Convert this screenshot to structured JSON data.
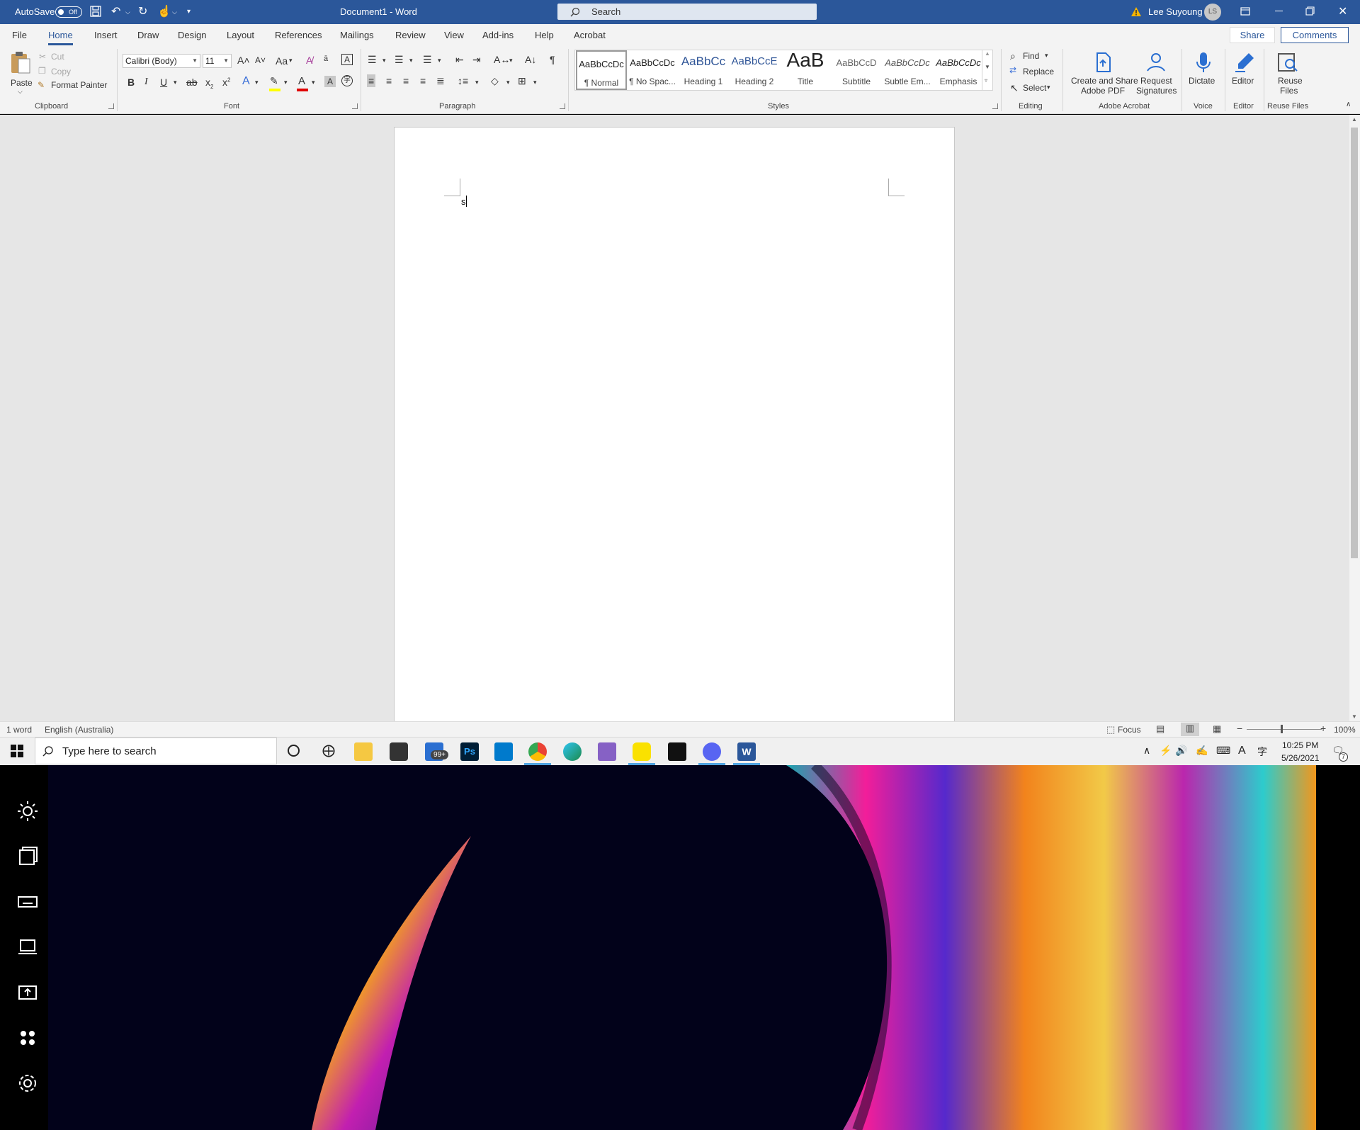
{
  "titlebar": {
    "autosave_label": "AutoSave",
    "autosave_state": "Off",
    "doc_title": "Document1  -  Word",
    "search_placeholder": "Search",
    "user_name": "Lee Suyoung",
    "user_initials": "LS",
    "accent": "#2b579a"
  },
  "tabs": [
    "File",
    "Home",
    "Insert",
    "Draw",
    "Design",
    "Layout",
    "References",
    "Mailings",
    "Review",
    "View",
    "Add-ins",
    "Help",
    "Acrobat"
  ],
  "active_tab": "Home",
  "share_label": "Share",
  "comments_label": "Comments",
  "ribbon": {
    "clipboard": {
      "paste": "Paste",
      "cut": "Cut",
      "copy": "Copy",
      "format_painter": "Format Painter",
      "label": "Clipboard"
    },
    "font": {
      "font_name": "Calibri (Body)",
      "font_size": "11",
      "label": "Font",
      "change_case": "Aa"
    },
    "paragraph": {
      "label": "Paragraph"
    },
    "styles": {
      "label": "Styles",
      "items": [
        {
          "preview": "AaBbCcDc",
          "name": "¶ Normal"
        },
        {
          "preview": "AaBbCcDc",
          "name": "¶ No Spac..."
        },
        {
          "preview": "AaBbCc",
          "name": "Heading 1"
        },
        {
          "preview": "AaBbCcE",
          "name": "Heading 2"
        },
        {
          "preview": "AaB",
          "name": "Title"
        },
        {
          "preview": "AaBbCcD",
          "name": "Subtitle"
        },
        {
          "preview": "AaBbCcDc",
          "name": "Subtle Em..."
        },
        {
          "preview": "AaBbCcDc",
          "name": "Emphasis"
        }
      ]
    },
    "editing": {
      "find": "Find",
      "replace": "Replace",
      "select": "Select",
      "label": "Editing"
    },
    "acrobat": {
      "create_line1": "Create and Share",
      "create_line2": "Adobe PDF",
      "request_line1": "Request",
      "request_line2": "Signatures",
      "label": "Adobe Acrobat"
    },
    "voice": {
      "dictate": "Dictate",
      "label": "Voice"
    },
    "editor": {
      "editor": "Editor",
      "label": "Editor"
    },
    "reuse": {
      "line1": "Reuse",
      "line2": "Files",
      "label": "Reuse Files"
    }
  },
  "document": {
    "text": "s"
  },
  "statusbar": {
    "word_count": "1 word",
    "language": "English (Australia)",
    "focus": "Focus",
    "zoom": "100%"
  },
  "taskbar": {
    "search_placeholder": "Type here to search",
    "mail_badge": "99+",
    "time": "10:25 PM",
    "date": "5/26/2021",
    "notification_count": "7"
  },
  "icons": {
    "start": "windows-start-icon",
    "cortana": "cortana-circle-icon",
    "taskview": "task-view-icon",
    "apps": [
      "file-explorer-icon",
      "store-icon",
      "mail-icon",
      "photoshop-icon",
      "vscode-icon",
      "chrome-icon",
      "edge-icon",
      "visual-studio-icon",
      "kakaotalk-icon",
      "terminal-icon",
      "discord-icon",
      "word-icon"
    ]
  }
}
